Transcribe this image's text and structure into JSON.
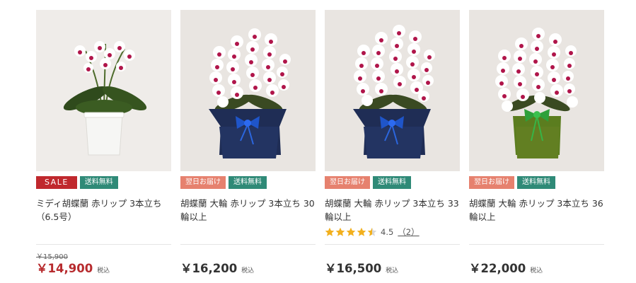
{
  "products": [
    {
      "badges": [
        {
          "label": "SALE",
          "type": "sale"
        },
        {
          "label": "送料無料",
          "type": "free"
        }
      ],
      "title": "ミディ胡蝶蘭 赤リップ 3本立ち（6.5号）",
      "old_price": "￥15,900",
      "price": "￥14,900",
      "tax_label": "税込",
      "pot_color": "#f4f4f2",
      "bg_color": "#efece9"
    },
    {
      "badges": [
        {
          "label": "翌日お届け",
          "type": "next"
        },
        {
          "label": "送料無料",
          "type": "free"
        }
      ],
      "title": "胡蝶蘭 大輪 赤リップ 3本立ち 30輪以上",
      "price": "￥16,200",
      "tax_label": "税込",
      "pot_color": "#1f2d55",
      "bow_color": "#1f55c9",
      "bg_color": "#e9e5e1"
    },
    {
      "badges": [
        {
          "label": "翌日お届け",
          "type": "next"
        },
        {
          "label": "送料無料",
          "type": "free"
        }
      ],
      "title": "胡蝶蘭 大輪 赤リップ 3本立ち 33輪以上",
      "rating": {
        "value": 4.5,
        "score_label": "4.5",
        "count_label": "（2）"
      },
      "price": "￥16,500",
      "tax_label": "税込",
      "pot_color": "#1f2d55",
      "bow_color": "#1f55c9",
      "bg_color": "#e9e5e1"
    },
    {
      "badges": [
        {
          "label": "翌日お届け",
          "type": "next"
        },
        {
          "label": "送料無料",
          "type": "free"
        }
      ],
      "title": "胡蝶蘭 大輪 赤リップ 3本立ち 36輪以上",
      "price": "￥22,000",
      "tax_label": "税込",
      "pot_color": "#5b7d1f",
      "bow_color": "#2ea03a",
      "bg_color": "#e9e5e1"
    }
  ],
  "colors": {
    "sale_badge": "#c0282d",
    "next_day_badge": "#e6816e",
    "free_shipping_badge": "#2f8a77",
    "sale_price": "#b72b2e",
    "star": "#f2b01e",
    "orchid_lip": "#b0154a"
  },
  "icons": [
    "star-icon"
  ]
}
